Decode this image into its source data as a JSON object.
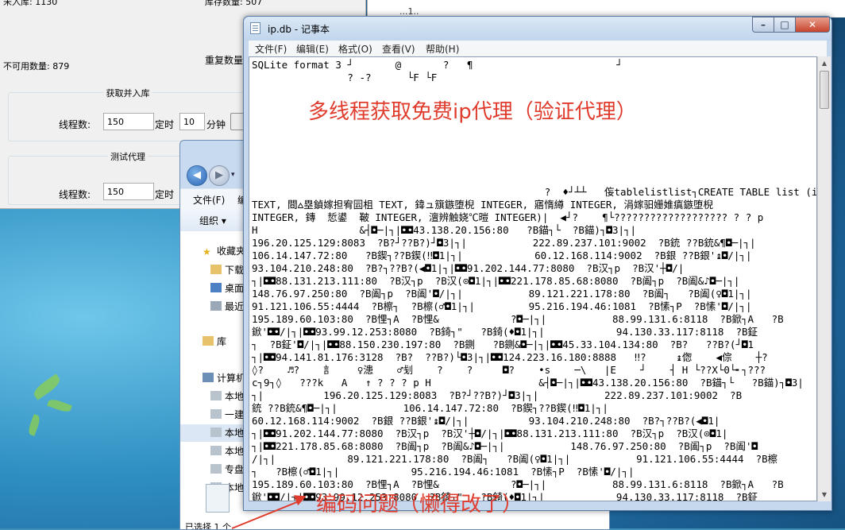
{
  "app": {
    "topcut_left": "未入库: 1130",
    "topcut_right": "库存数量: 507",
    "unavailable_label": "不可用数量: 879",
    "duplicate_label": "重复数量",
    "group1_title": "获取并入库",
    "group2_title": "测试代理",
    "threads_label": "线程数:",
    "threads_value_1": "150",
    "threads_value_2": "150",
    "timer_label": "定时",
    "timer_value": "10",
    "minutes_label": "分钟"
  },
  "whitewin": {
    "text": "...1.."
  },
  "explorer": {
    "menu_file": "文件(F)",
    "menu_edit": "编",
    "organize": "组织 ▾",
    "nav_items": [
      "收藏夹",
      "下载",
      "桌面",
      "最近",
      "库",
      "计算机",
      "本地",
      "一建",
      "本地",
      "本地",
      "专盘",
      "本地"
    ],
    "status": "已选择 1 个"
  },
  "notepad": {
    "title": "ip.db - 记事本",
    "menus": [
      "文件(F)",
      "编辑(E)",
      "格式(O)",
      "查看(V)",
      "帮助(H)"
    ],
    "lines": [
      "SQLite format 3 ┘       @       ?   ¶                        ┘",
      "                ? -?      └F └F",
      "",
      "",
      "",
      "",
      "",
      "",
      "",
      "",
      "                                                 ?  ♦┘┴┴   侫tablelistlist┐CREATE TABLE list (ip",
      "TEXT, 閸⩟塁鍞嫁担宥囩柤 TEXT, 鍏ュ簱鏃堕棿 INTEGER, 寤惰繜 INTEGER, 涓嫁驲姗婎瘨鏃堕棿",
      "INTEGER, 鏄  悊鍙  鞁 INTEGER, 澶辨触娆℃暟 INTEGER)|  ◀┘?    ¶└??????????????????? ? ? p",
      "H                 &┤◘─|┐|◘◘43.138.20.156:80   ?B錨┐└  ?B錨)┐◘3|┐|",
      "196.20.125.129:8083  ?B?┘??B?)┘◘3|┐|           222.89.237.101:9002  ?B銃 ??B銃&¶◘─|┐|",
      "106.14.147.72:80   ?B鍥┐??B鍥(‼◘1|┐|            60.12.168.114:9002  ?B銀 ??B銀'↨◘/|┐|",
      "93.104.210.248:80  ?B?┐??B?(◀◘1|┐|◘◘91.202.144.77:8080  ?B汉┐p  ?B汉'┼◘/|",
      "┐|◘◘88.131.213.111:80  ?B汉┐p  ?B汉(⊙◘1|┐|◘◘221.178.85.68:8080  ?B阖┐p  ?B阖&♪◘─|┐|",
      "148.76.97.250:80  ?B阖┐p  ?B阖'◘/|┐|           89.121.221.178:80  ?B阖┐   ?B阖(♀◘1|┐|",
      "91.121.106.55:4444  ?B檫┐  ?B檫(♂◘1|┐|         95.216.194.46:1081  ?B愫┐P  ?B愫'◘/|┐|",
      "195.189.60.103:80  ?B悝┐A  ?B悝&            ?◘─|┐|           88.99.131.6:8118  ?B鍁┐A   ?B",
      "鍁'◘◘/|┐|◘◘93.99.12.253:8080  ?B錡┐\"   ?B錡(♦◘1|┐|            94.130.33.117:8118  ?B鉦",
      "┐  ?B鉦'◘/|┐|◘◘88.150.230.197:80  ?B鍘   ?B鍘&◘─|┐|◘◘45.33.104.134:80  ?B?   ??B?(┘◘1",
      "┐|◘◘94.141.81.176:3128  ?B?  ??B?)└◘3|┐|◘◘124.223.16.180:8888   ‼?     ↨偬    ◀倧    ┼?",
      "◊?    ♬?    訁    ♀漶    ♂刬    ?    ?     ◘?    •s    ─\\   |E    ┘    ┤ H └??X└0└╸┐???",
      "c┐9┐◊   ???k   A   ↑ ? ? ? p H                  &┤◘─|┐|◘◘43.138.20.156:80  ?B錨┐└   ?B錨)┐◘3|",
      "┐|          196.20.125.129:8083  ?B?┘??B?)┘◘3|┐|           222.89.237.101:9002  ?B",
      "銃 ??B銃&¶◘─|┐|           106.14.147.72:80  ?B鍥┐??B鍥(‼◘1|┐|",
      "60.12.168.114:9002  ?B銀 ??B銀'↨◘/|┐|          93.104.210.248:80  ?B?┐??B?(◀◘1|",
      "┐|◘◘91.202.144.77:8080  ?B汉┐p  ?B汉'┼◘/|┐|◘◘88.131.213.111:80  ?B汉┐p  ?B汉(⊙◘1|",
      "┐|◘◘221.178.85.68:8080  ?B阖┐p  ?B阖&♪◘─|┐|           148.76.97.250:80  ?B阖┐p  ?B阖'◘",
      "/|┐|            89.121.221.178:80  ?B阖┐   ?B阖(♀◘1|┐|           91.121.106.55:4444  ?B檫",
      "┐   ?B檫(♂◘1|┐|            95.216.194.46:1081  ?B愫┐P  ?B愫'◘/|┐|",
      "195.189.60.103:80  ?B悝┐A  ?B悝&            ?◘─|┐|           88.99.131.6:8118  ?B鍁┐A   ?B",
      "鍁'◘◘/|┐|◘◘93.99.12.253:8080  ?B錡┐\"   ?B錡(♦◘1|┐|            94.130.33.117:8118  ?B鉦"
    ]
  },
  "annotations": {
    "top": "多线程获取免费ip代理（验证代理）",
    "bottom": "编码问题（懒得改了）",
    "color": "#e03c2d"
  }
}
